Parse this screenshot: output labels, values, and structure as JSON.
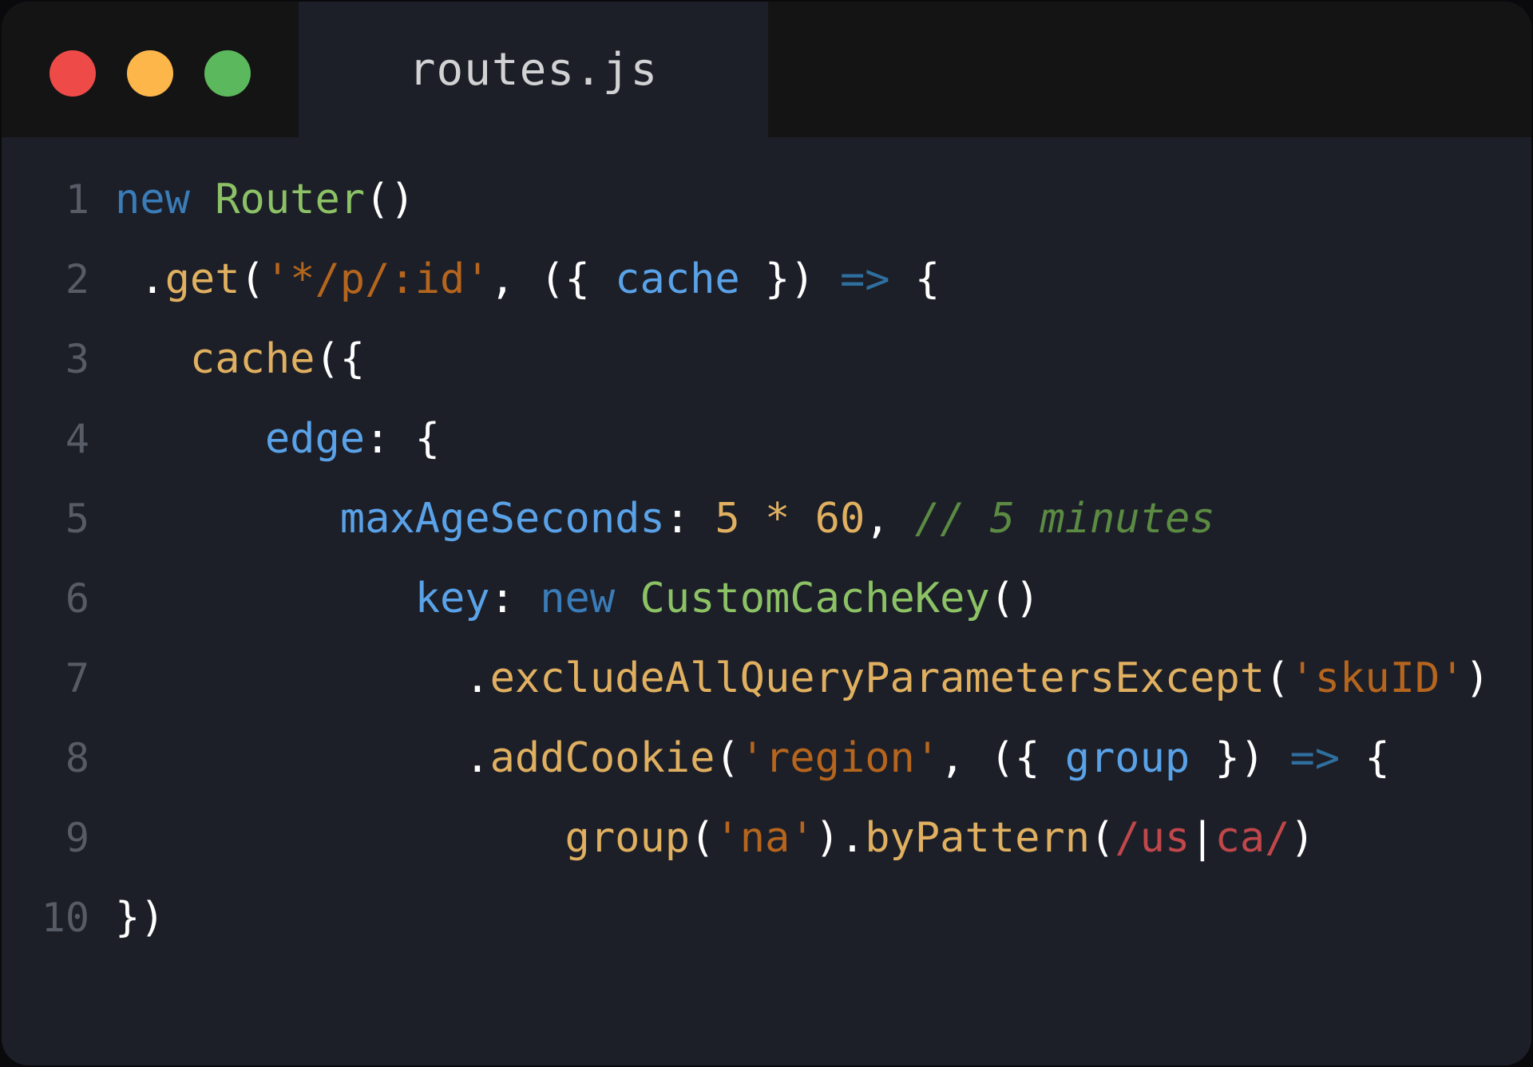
{
  "window": {
    "titlebar": {
      "traffic_lights": [
        {
          "name": "close",
          "color": "#ee4b48"
        },
        {
          "name": "minimize",
          "color": "#fcb64a"
        },
        {
          "name": "maximize",
          "color": "#5cb85c"
        }
      ],
      "tab": {
        "label": "routes.js"
      }
    },
    "background": "#1c1f28",
    "titlebar_background": "#141415"
  },
  "editor": {
    "language": "javascript",
    "line_numbers": [
      "1",
      "2",
      "3",
      "4",
      "5",
      "6",
      "7",
      "8",
      "9",
      "10"
    ],
    "lines": [
      {
        "number": "1",
        "text": "new Router()",
        "tokens": [
          {
            "t": "new",
            "c": "tok-keyword"
          },
          {
            "t": " ",
            "c": "tok-plain"
          },
          {
            "t": "Router",
            "c": "tok-class"
          },
          {
            "t": "()",
            "c": "tok-plain"
          }
        ]
      },
      {
        "number": "2",
        "text": " .get('*/p/:id', ({ cache }) => {",
        "tokens": [
          {
            "t": " .",
            "c": "tok-plain"
          },
          {
            "t": "get",
            "c": "tok-func"
          },
          {
            "t": "(",
            "c": "tok-plain"
          },
          {
            "t": "'*/p/:id'",
            "c": "tok-string"
          },
          {
            "t": ", ({ ",
            "c": "tok-plain"
          },
          {
            "t": "cache",
            "c": "tok-prop"
          },
          {
            "t": " }) ",
            "c": "tok-plain"
          },
          {
            "t": "=>",
            "c": "tok-arrow"
          },
          {
            "t": " {",
            "c": "tok-plain"
          }
        ]
      },
      {
        "number": "3",
        "text": "   cache({",
        "tokens": [
          {
            "t": "   ",
            "c": "tok-plain"
          },
          {
            "t": "cache",
            "c": "tok-func"
          },
          {
            "t": "({",
            "c": "tok-plain"
          }
        ]
      },
      {
        "number": "4",
        "text": "      edge: {",
        "tokens": [
          {
            "t": "      ",
            "c": "tok-plain"
          },
          {
            "t": "edge",
            "c": "tok-prop"
          },
          {
            "t": ": {",
            "c": "tok-plain"
          }
        ]
      },
      {
        "number": "5",
        "text": "         maxAgeSeconds: 5 * 60, // 5 minutes",
        "tokens": [
          {
            "t": "         ",
            "c": "tok-plain"
          },
          {
            "t": "maxAgeSeconds",
            "c": "tok-prop"
          },
          {
            "t": ": ",
            "c": "tok-plain"
          },
          {
            "t": "5",
            "c": "tok-number"
          },
          {
            "t": " ",
            "c": "tok-plain"
          },
          {
            "t": "*",
            "c": "tok-op"
          },
          {
            "t": " ",
            "c": "tok-plain"
          },
          {
            "t": "60",
            "c": "tok-number"
          },
          {
            "t": ", ",
            "c": "tok-plain"
          },
          {
            "t": "// 5 minutes",
            "c": "tok-comment"
          }
        ]
      },
      {
        "number": "6",
        "text": "            key: new CustomCacheKey()",
        "tokens": [
          {
            "t": "            ",
            "c": "tok-plain"
          },
          {
            "t": "key",
            "c": "tok-prop"
          },
          {
            "t": ": ",
            "c": "tok-plain"
          },
          {
            "t": "new",
            "c": "tok-keyword"
          },
          {
            "t": " ",
            "c": "tok-plain"
          },
          {
            "t": "CustomCacheKey",
            "c": "tok-class"
          },
          {
            "t": "()",
            "c": "tok-plain"
          }
        ]
      },
      {
        "number": "7",
        "text": "              .excludeAllQueryParametersExcept('skuID')",
        "tokens": [
          {
            "t": "              ",
            "c": "tok-plain"
          },
          {
            "t": ".",
            "c": "tok-plain"
          },
          {
            "t": "excludeAllQueryParametersExcept",
            "c": "tok-func"
          },
          {
            "t": "(",
            "c": "tok-plain"
          },
          {
            "t": "'skuID'",
            "c": "tok-string"
          },
          {
            "t": ")",
            "c": "tok-plain"
          }
        ]
      },
      {
        "number": "8",
        "text": "              .addCookie('region', ({ group }) => {",
        "tokens": [
          {
            "t": "              ",
            "c": "tok-plain"
          },
          {
            "t": ".",
            "c": "tok-plain"
          },
          {
            "t": "addCookie",
            "c": "tok-func"
          },
          {
            "t": "(",
            "c": "tok-plain"
          },
          {
            "t": "'region'",
            "c": "tok-string"
          },
          {
            "t": ", ({ ",
            "c": "tok-plain"
          },
          {
            "t": "group",
            "c": "tok-prop"
          },
          {
            "t": " }) ",
            "c": "tok-plain"
          },
          {
            "t": "=>",
            "c": "tok-arrow"
          },
          {
            "t": " {",
            "c": "tok-plain"
          }
        ]
      },
      {
        "number": "9",
        "text": "                  group('na').byPattern(/us|ca/)",
        "tokens": [
          {
            "t": "                  ",
            "c": "tok-plain"
          },
          {
            "t": "group",
            "c": "tok-func"
          },
          {
            "t": "(",
            "c": "tok-plain"
          },
          {
            "t": "'na'",
            "c": "tok-string"
          },
          {
            "t": ").",
            "c": "tok-plain"
          },
          {
            "t": "byPattern",
            "c": "tok-func"
          },
          {
            "t": "(",
            "c": "tok-plain"
          },
          {
            "t": "/us",
            "c": "tok-regex"
          },
          {
            "t": "|",
            "c": "tok-regex-sep"
          },
          {
            "t": "ca/",
            "c": "tok-regex"
          },
          {
            "t": ")",
            "c": "tok-plain"
          }
        ]
      },
      {
        "number": "10",
        "text": "})",
        "tokens": [
          {
            "t": "})",
            "c": "tok-plain"
          }
        ]
      }
    ],
    "colors": {
      "background": "#1c1f28",
      "gutter_text": "#565b66",
      "plain": "#ffffff",
      "keyword": "#3a7cb8",
      "class": "#8cc265",
      "function": "#e0b060",
      "property": "#5aa2e8",
      "string": "#b5651d",
      "number": "#e0b060",
      "arrow": "#2f6f9f",
      "comment": "#5b8a43",
      "regex": "#c0474a"
    }
  }
}
